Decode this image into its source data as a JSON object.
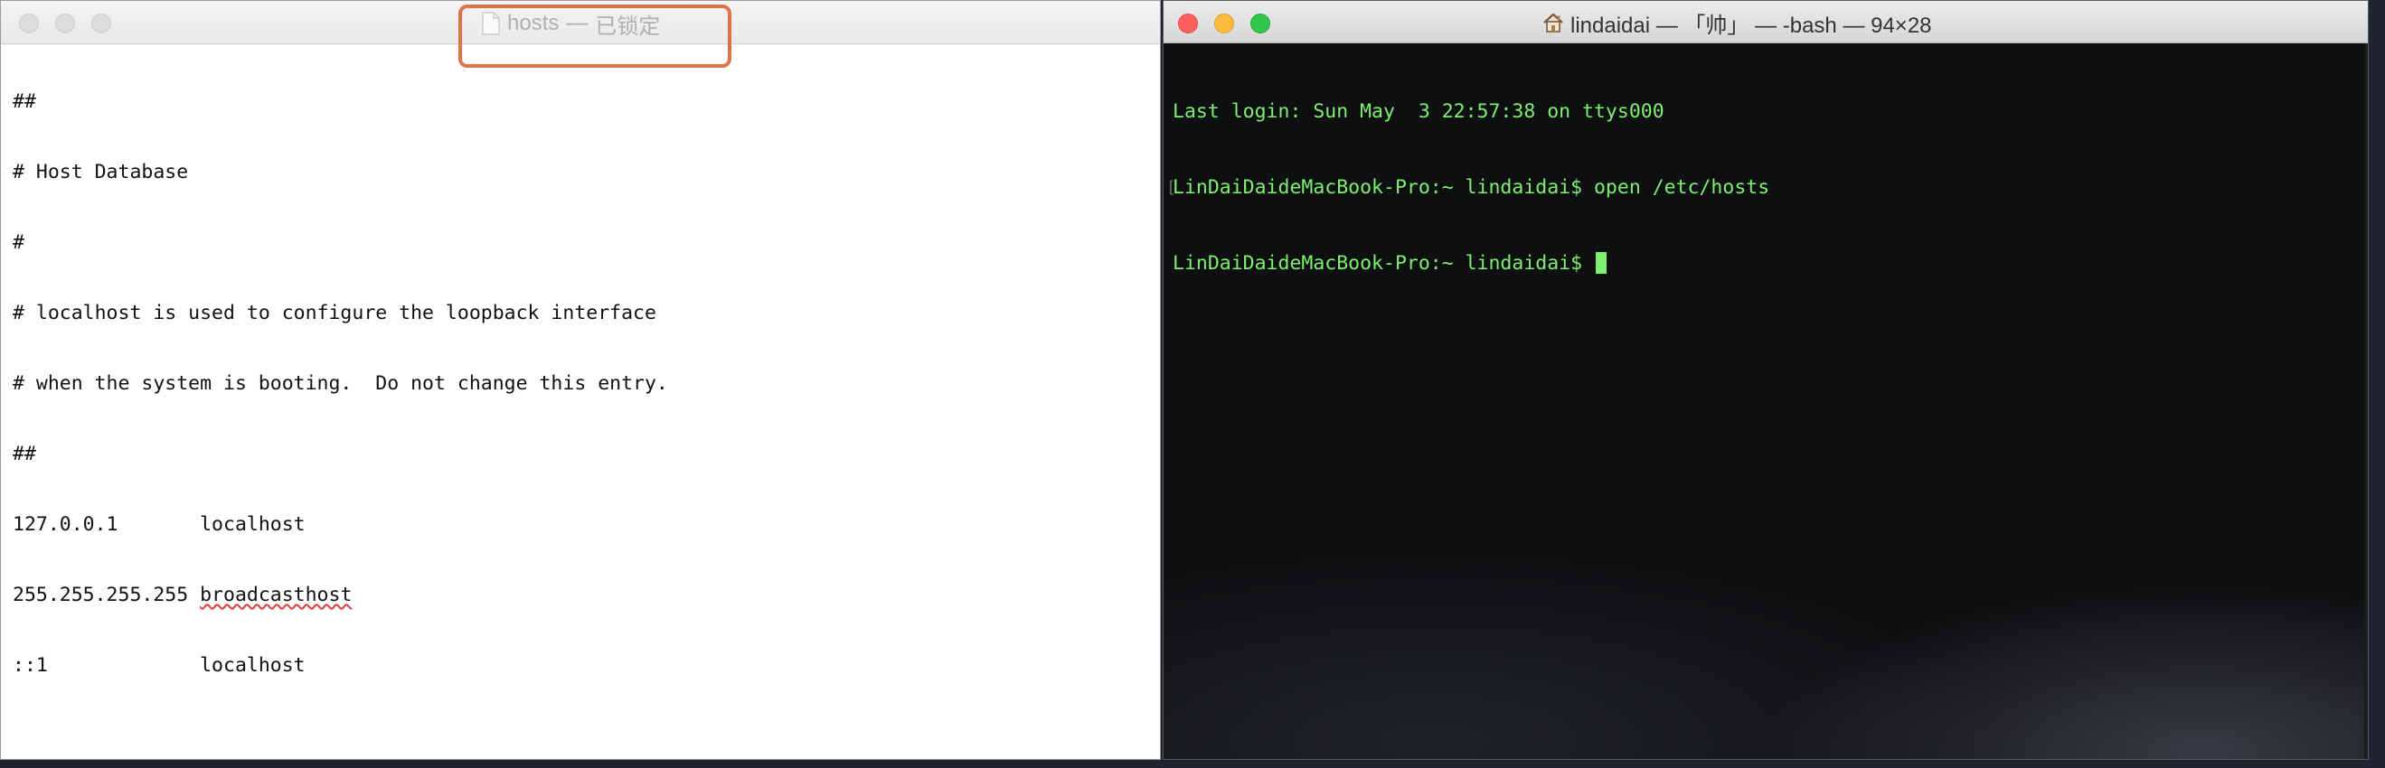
{
  "textedit": {
    "title_name": "hosts",
    "title_sep": "—",
    "title_status": "已锁定",
    "lines": [
      "##",
      "# Host Database",
      "#",
      "# localhost is used to configure the loopback interface",
      "# when the system is booting.  Do not change this entry.",
      "##",
      "127.0.0.1       localhost",
      "255.255.255.255 ",
      "::1             localhost"
    ],
    "misspelled_word": "broadcasthost",
    "icon": "document-icon",
    "highlight_color": "#e0724a"
  },
  "terminal": {
    "title": "lindaidai — 「帅」 — -bash — 94×28",
    "icon": "home-icon",
    "lines": [
      "Last login: Sun May  3 22:57:38 on ttys000",
      "LinDaiDaideMacBook-Pro:~ lindaidai$ open /etc/hosts",
      "LinDaiDaideMacBook-Pro:~ lindaidai$ "
    ],
    "text_color": "#7ef070",
    "traffic_colors": {
      "close": "#fc605c",
      "minimize": "#fdbc40",
      "zoom": "#34c84a"
    }
  }
}
